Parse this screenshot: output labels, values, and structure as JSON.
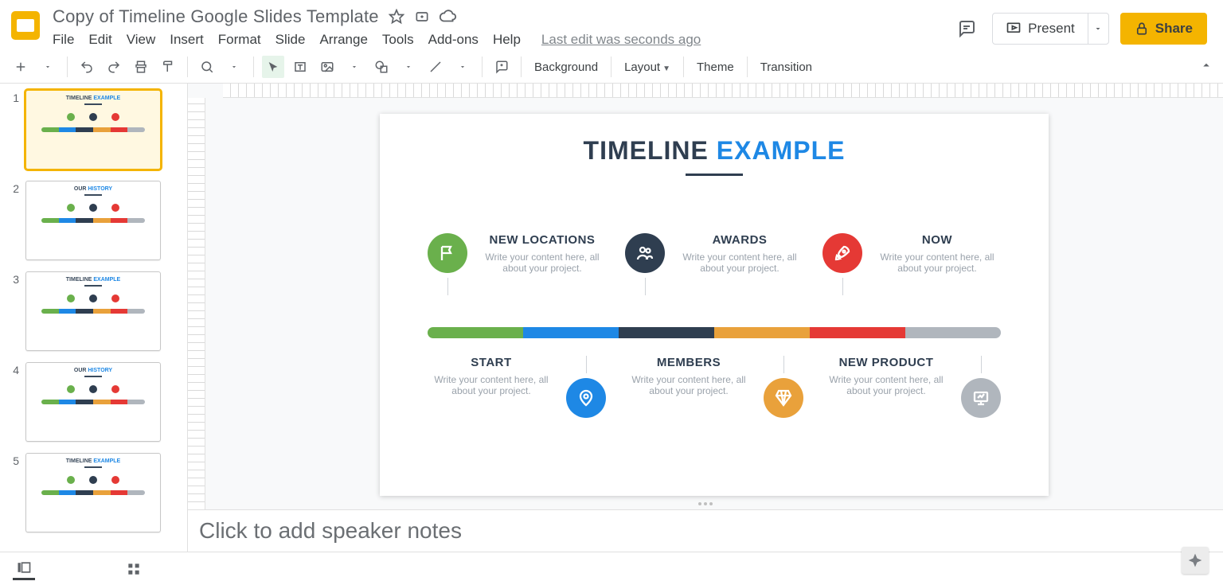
{
  "doc": {
    "title": "Copy of Timeline Google Slides Template"
  },
  "menu": [
    "File",
    "Edit",
    "View",
    "Insert",
    "Format",
    "Slide",
    "Arrange",
    "Tools",
    "Add-ons",
    "Help"
  ],
  "last_edit": "Last edit was seconds ago",
  "header_actions": {
    "present": "Present",
    "share": "Share"
  },
  "toolbar": {
    "background": "Background",
    "layout": "Layout",
    "theme": "Theme",
    "transition": "Transition"
  },
  "thumbnails": [
    {
      "num": "1",
      "title_a": "TIMELINE",
      "title_b": "EXAMPLE",
      "selected": true
    },
    {
      "num": "2",
      "title_a": "OUR",
      "title_b": "HISTORY"
    },
    {
      "num": "3",
      "title_a": "TIMELINE",
      "title_b": "EXAMPLE"
    },
    {
      "num": "4",
      "title_a": "OUR",
      "title_b": "HISTORY"
    },
    {
      "num": "5",
      "title_a": "TIMELINE",
      "title_b": "EXAMPLE"
    }
  ],
  "slide": {
    "title_a": "TIMELINE",
    "title_b": "EXAMPLE",
    "desc": "Write your content here, all about your project.",
    "top_items": [
      {
        "label": "NEW LOCATIONS",
        "color": "c-green",
        "icon": "flag"
      },
      {
        "label": "AWARDS",
        "color": "c-dark",
        "icon": "users"
      },
      {
        "label": "NOW",
        "color": "c-red",
        "icon": "rocket"
      }
    ],
    "bottom_items": [
      {
        "label": "START",
        "color": "c-blue",
        "icon": "pin"
      },
      {
        "label": "MEMBERS",
        "color": "c-orange",
        "icon": "diamond"
      },
      {
        "label": "NEW PRODUCT",
        "color": "c-grey",
        "icon": "presentation"
      }
    ],
    "segments": [
      "c-green",
      "c-blue",
      "c-dark",
      "c-orange",
      "c-red",
      "c-grey"
    ]
  },
  "notes": {
    "placeholder": "Click to add speaker notes"
  },
  "colors": {
    "green": "#6ab04c",
    "blue": "#1e88e5",
    "dark": "#2f3e50",
    "orange": "#e9a13b",
    "red": "#e53935",
    "grey": "#b0b6bd",
    "accent": "#f4b400"
  }
}
